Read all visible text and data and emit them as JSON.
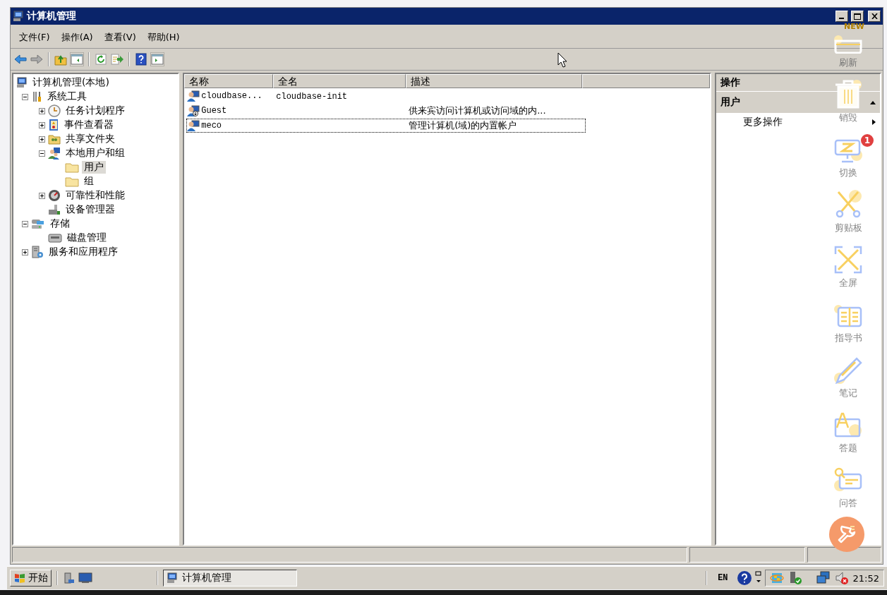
{
  "window": {
    "title": "计算机管理"
  },
  "menu": [
    {
      "label": "文件(F)"
    },
    {
      "label": "操作(A)"
    },
    {
      "label": "查看(V)"
    },
    {
      "label": "帮助(H)"
    }
  ],
  "tree": [
    {
      "label": "计算机管理(本地)",
      "selected": false,
      "children": [
        {
          "label": "系统工具",
          "expanded": true,
          "selected": false,
          "children": [
            {
              "label": "任务计划程序",
              "expanded": false,
              "selected": false
            },
            {
              "label": "事件查看器",
              "expanded": false,
              "selected": false
            },
            {
              "label": "共享文件夹",
              "expanded": false,
              "selected": false
            },
            {
              "label": "本地用户和组",
              "expanded": true,
              "selected": false,
              "children": [
                {
                  "label": "用户",
                  "selected": true
                },
                {
                  "label": "组",
                  "selected": false
                }
              ]
            },
            {
              "label": "可靠性和性能",
              "expanded": false,
              "selected": false
            },
            {
              "label": "设备管理器",
              "selected": false
            }
          ]
        },
        {
          "label": "存储",
          "expanded": true,
          "selected": false,
          "children": [
            {
              "label": "磁盘管理",
              "selected": false
            }
          ]
        },
        {
          "label": "服务和应用程序",
          "expanded": false,
          "selected": false
        }
      ]
    }
  ],
  "list": {
    "columns": [
      "名称",
      "全名",
      "描述"
    ],
    "rows": [
      {
        "name": "cloudbase...",
        "full_name": "cloudbase-init",
        "selected": false
      },
      {
        "name": "Guest",
        "description": "供来宾访问计算机或访问域的内...",
        "selected": false
      },
      {
        "name": "meco",
        "description": "管理计算机(域)的内置帐户",
        "selected": true
      }
    ]
  },
  "actions": {
    "title": "操作",
    "section": {
      "label": "用户",
      "expanded": true
    },
    "items": [
      {
        "label": "更多操作"
      }
    ]
  },
  "overlay": {
    "new_tag": "NEW",
    "badge": "1",
    "items": [
      {
        "label": "刷新",
        "kind": "new"
      },
      {
        "label": "销毁",
        "kind": "trash"
      },
      {
        "label": "切换",
        "kind": "switch"
      },
      {
        "label": "剪贴板",
        "kind": "scissors"
      },
      {
        "label": "全屏",
        "kind": "fullscreen"
      },
      {
        "label": "指导书",
        "kind": "book"
      },
      {
        "label": "笔记",
        "kind": "pen"
      },
      {
        "label": "答题",
        "kind": "answer"
      },
      {
        "label": "问答",
        "kind": "qa"
      }
    ]
  },
  "taskbar": {
    "start": "开始",
    "task": "计算机管理",
    "language": "EN",
    "clock": "21:52"
  }
}
